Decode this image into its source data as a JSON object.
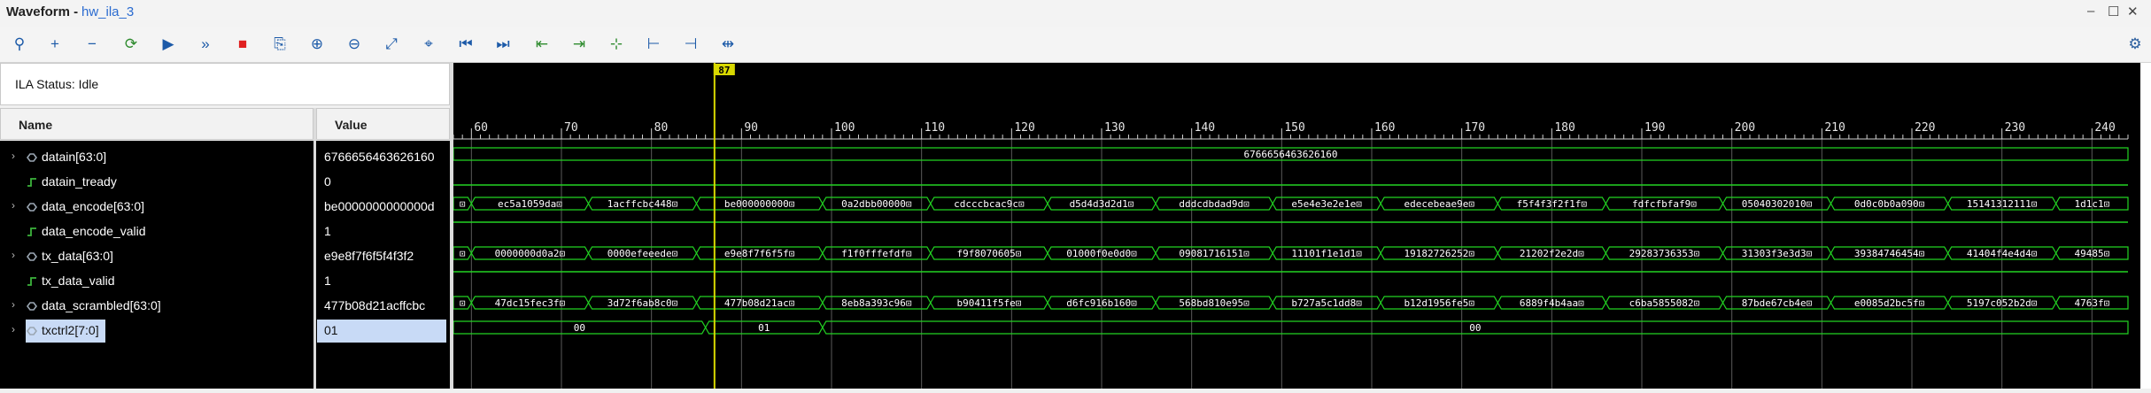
{
  "window": {
    "title": "Waveform - ",
    "name": "hw_ila_3",
    "minimize": "–",
    "maximize": "☐",
    "close": "✕"
  },
  "toolbar": [
    {
      "name": "search-icon",
      "glyph": "⚲"
    },
    {
      "name": "add-icon",
      "glyph": "+"
    },
    {
      "name": "remove-icon",
      "glyph": "−"
    },
    {
      "name": "refresh-icon",
      "glyph": "⟳"
    },
    {
      "name": "run-trigger-icon",
      "glyph": "▶"
    },
    {
      "name": "run-immediate-icon",
      "glyph": "»"
    },
    {
      "name": "stop-icon",
      "glyph": "■"
    },
    {
      "name": "export-icon",
      "glyph": "⎘"
    },
    {
      "name": "zoom-in-icon",
      "glyph": "⊕"
    },
    {
      "name": "zoom-out-icon",
      "glyph": "⊖"
    },
    {
      "name": "zoom-fit-icon",
      "glyph": "⤢"
    },
    {
      "name": "go-to-cursor-icon",
      "glyph": "⌖"
    },
    {
      "name": "go-to-time-zero-icon",
      "glyph": "⏮"
    },
    {
      "name": "go-to-last-time-icon",
      "glyph": "⏭"
    },
    {
      "name": "previous-transition-icon",
      "glyph": "⇤"
    },
    {
      "name": "next-transition-icon",
      "glyph": "⇥"
    },
    {
      "name": "add-marker-icon",
      "glyph": "⊹"
    },
    {
      "name": "previous-marker-icon",
      "glyph": "⊢"
    },
    {
      "name": "next-marker-icon",
      "glyph": "⊣"
    },
    {
      "name": "swap-cursors-icon",
      "glyph": "⇹"
    }
  ],
  "settings_icon": "⚙",
  "ila_status": "ILA Status: Idle",
  "columns": {
    "name": "Name",
    "value": "Value"
  },
  "signals": [
    {
      "name": "datain[63:0]",
      "value": "6766656463626160",
      "bus": true
    },
    {
      "name": "datain_tready",
      "value": "0",
      "bus": false
    },
    {
      "name": "data_encode[63:0]",
      "value": "be0000000000000d",
      "bus": true
    },
    {
      "name": "data_encode_valid",
      "value": "1",
      "bus": false
    },
    {
      "name": "tx_data[63:0]",
      "value": "e9e8f7f6f5f4f3f2",
      "bus": true
    },
    {
      "name": "tx_data_valid",
      "value": "1",
      "bus": false
    },
    {
      "name": "data_scrambled[63:0]",
      "value": "477b08d21acffcbc",
      "bus": true
    },
    {
      "name": "txctrl2[7:0]",
      "value": "01",
      "bus": true,
      "selected": true
    }
  ],
  "cursor": {
    "time": 87,
    "label": "87"
  },
  "axis": {
    "start": 58,
    "end": 244,
    "ticks": [
      60,
      70,
      80,
      90,
      100,
      110,
      120,
      130,
      140,
      150,
      160,
      170,
      180,
      190,
      200,
      210,
      220,
      230,
      240
    ]
  },
  "waveforms": {
    "datain": {
      "segments": [
        {
          "t0": 58,
          "t1": 244,
          "label": "6766656463626160"
        }
      ]
    },
    "datain_tready": {
      "level": 0
    },
    "data_encode": {
      "segments": [
        {
          "t0": 58,
          "t1": 60,
          "label": "⊡"
        },
        {
          "t0": 60,
          "t1": 73,
          "label": "ec5a1059da⊡"
        },
        {
          "t0": 73,
          "t1": 85,
          "label": "1acffcbc448⊡"
        },
        {
          "t0": 85,
          "t1": 99,
          "label": "be000000000⊡"
        },
        {
          "t0": 99,
          "t1": 111,
          "label": "0a2dbb00000⊡"
        },
        {
          "t0": 111,
          "t1": 124,
          "label": "cdcccbcac9c⊡"
        },
        {
          "t0": 124,
          "t1": 136,
          "label": "d5d4d3d2d1⊡"
        },
        {
          "t0": 136,
          "t1": 149,
          "label": "dddcdbdad9d⊡"
        },
        {
          "t0": 149,
          "t1": 161,
          "label": "e5e4e3e2e1e⊡"
        },
        {
          "t0": 161,
          "t1": 174,
          "label": "edecebeae9e⊡"
        },
        {
          "t0": 174,
          "t1": 186,
          "label": "f5f4f3f2f1f⊡"
        },
        {
          "t0": 186,
          "t1": 199,
          "label": "fdfcfbfaf9⊡"
        },
        {
          "t0": 199,
          "t1": 211,
          "label": "05040302010⊡"
        },
        {
          "t0": 211,
          "t1": 224,
          "label": "0d0c0b0a090⊡"
        },
        {
          "t0": 224,
          "t1": 236,
          "label": "15141312111⊡"
        },
        {
          "t0": 236,
          "t1": 244,
          "label": "1d1c1⊡"
        }
      ]
    },
    "data_encode_valid": {
      "level": 1
    },
    "tx_data": {
      "segments": [
        {
          "t0": 58,
          "t1": 60,
          "label": "⊡"
        },
        {
          "t0": 60,
          "t1": 73,
          "label": "0000000d0a2⊡"
        },
        {
          "t0": 73,
          "t1": 85,
          "label": "0000efeeede⊡"
        },
        {
          "t0": 85,
          "t1": 99,
          "label": "e9e8f7f6f5f⊡"
        },
        {
          "t0": 99,
          "t1": 111,
          "label": "f1f0fffefdf⊡"
        },
        {
          "t0": 111,
          "t1": 124,
          "label": "f9f8070605⊡"
        },
        {
          "t0": 124,
          "t1": 136,
          "label": "01000f0e0d0⊡"
        },
        {
          "t0": 136,
          "t1": 149,
          "label": "09081716151⊡"
        },
        {
          "t0": 149,
          "t1": 161,
          "label": "11101f1e1d1⊡"
        },
        {
          "t0": 161,
          "t1": 174,
          "label": "19182726252⊡"
        },
        {
          "t0": 174,
          "t1": 186,
          "label": "21202f2e2d⊡"
        },
        {
          "t0": 186,
          "t1": 199,
          "label": "29283736353⊡"
        },
        {
          "t0": 199,
          "t1": 211,
          "label": "31303f3e3d3⊡"
        },
        {
          "t0": 211,
          "t1": 224,
          "label": "39384746454⊡"
        },
        {
          "t0": 224,
          "t1": 236,
          "label": "41404f4e4d4⊡"
        },
        {
          "t0": 236,
          "t1": 244,
          "label": "49485⊡"
        }
      ]
    },
    "tx_data_valid": {
      "level": 1
    },
    "data_scrambled": {
      "segments": [
        {
          "t0": 58,
          "t1": 60,
          "label": "⊡"
        },
        {
          "t0": 60,
          "t1": 73,
          "label": "47dc15fec3f⊡"
        },
        {
          "t0": 73,
          "t1": 85,
          "label": "3d72f6ab8c0⊡"
        },
        {
          "t0": 85,
          "t1": 99,
          "label": "477b08d21ac⊡"
        },
        {
          "t0": 99,
          "t1": 111,
          "label": "8eb8a393c96⊡"
        },
        {
          "t0": 111,
          "t1": 124,
          "label": "b90411f5fe⊡"
        },
        {
          "t0": 124,
          "t1": 136,
          "label": "d6fc916b160⊡"
        },
        {
          "t0": 136,
          "t1": 149,
          "label": "568bd810e95⊡"
        },
        {
          "t0": 149,
          "t1": 161,
          "label": "b727a5c1dd8⊡"
        },
        {
          "t0": 161,
          "t1": 174,
          "label": "b12d1956fe5⊡"
        },
        {
          "t0": 174,
          "t1": 186,
          "label": "6889f4b4aa⊡"
        },
        {
          "t0": 186,
          "t1": 199,
          "label": "c6ba5855082⊡"
        },
        {
          "t0": 199,
          "t1": 211,
          "label": "87bde67cb4e⊡"
        },
        {
          "t0": 211,
          "t1": 224,
          "label": "e0085d2bc5f⊡"
        },
        {
          "t0": 224,
          "t1": 236,
          "label": "5197c052b2d⊡"
        },
        {
          "t0": 236,
          "t1": 244,
          "label": "4763f⊡"
        }
      ]
    },
    "txctrl2": {
      "segments": [
        {
          "t0": 58,
          "t1": 86,
          "label": "00"
        },
        {
          "t0": 86,
          "t1": 99,
          "label": "01"
        },
        {
          "t0": 99,
          "t1": 244,
          "label": "00"
        }
      ]
    }
  },
  "colors": {
    "wave": "#22d422",
    "cursor": "#d8d800",
    "grid": "#5a5a5a",
    "tick": "#cfcfcf",
    "background": "#000000"
  }
}
